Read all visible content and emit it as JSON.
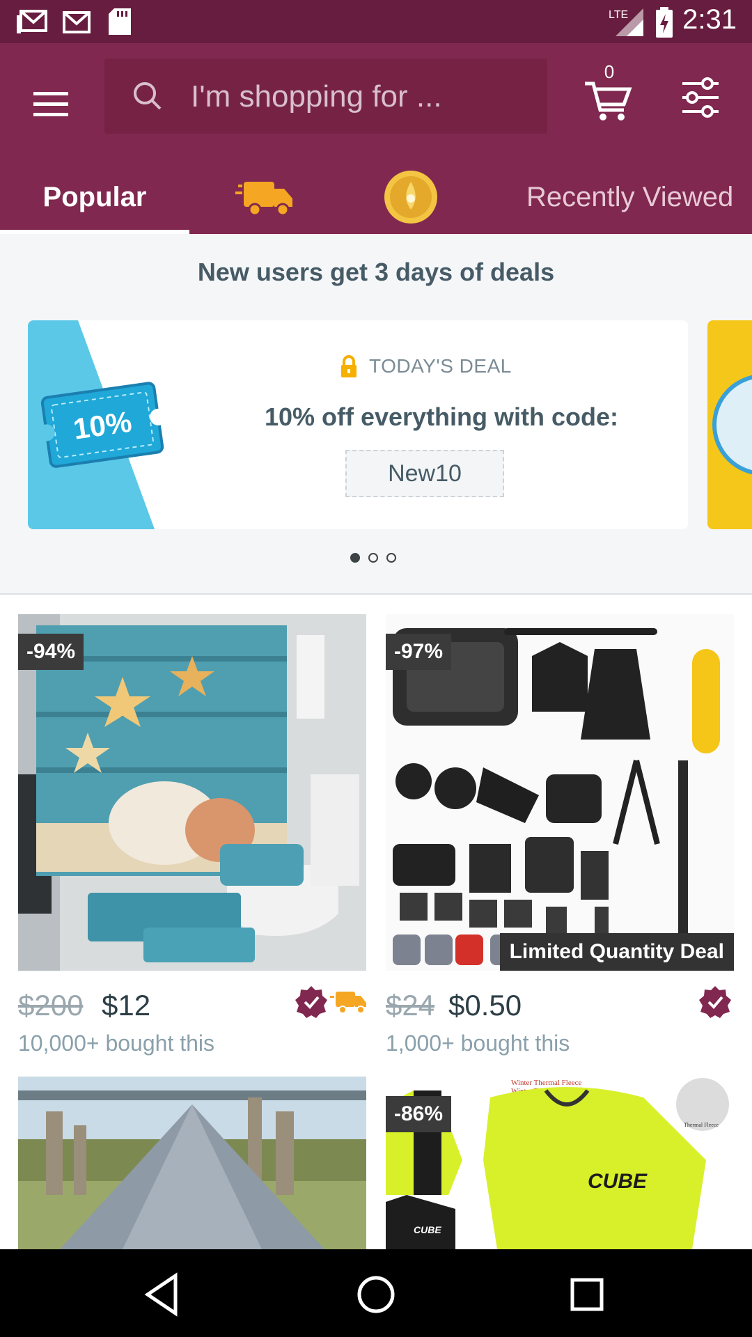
{
  "status_bar": {
    "time": "2:31",
    "network": "LTE"
  },
  "search": {
    "placeholder": "I'm shopping for ..."
  },
  "cart": {
    "count": "0"
  },
  "tabs": [
    {
      "label": "Popular"
    },
    {
      "label": "Recently Viewed"
    }
  ],
  "promo": {
    "title": "New users get 3 days of deals",
    "ticket_label": "10%",
    "tag": "TODAY'S DEAL",
    "text": "10% off everything with code:",
    "code": "New10"
  },
  "products": [
    {
      "discount": "-94%",
      "old_price": "$200",
      "price": "$12",
      "bought": "10,000+ bought this",
      "badge": ""
    },
    {
      "discount": "-97%",
      "old_price": "$24",
      "price": "$0.50",
      "bought": "1,000+ bought this",
      "badge": "Limited Quantity Deal"
    },
    {
      "discount": "",
      "old_price": "",
      "price": "",
      "bought": "",
      "badge": ""
    },
    {
      "discount": "-86%",
      "old_price": "",
      "price": "",
      "bought": "",
      "badge": "",
      "print": {
        "line1": "Winter Thermal Fleece",
        "brand": "CUBE",
        "patch": "Thermal Fleece"
      }
    }
  ],
  "colors": {
    "brand": "#80284f",
    "status": "#671d3f",
    "accent": "#f5a623"
  }
}
